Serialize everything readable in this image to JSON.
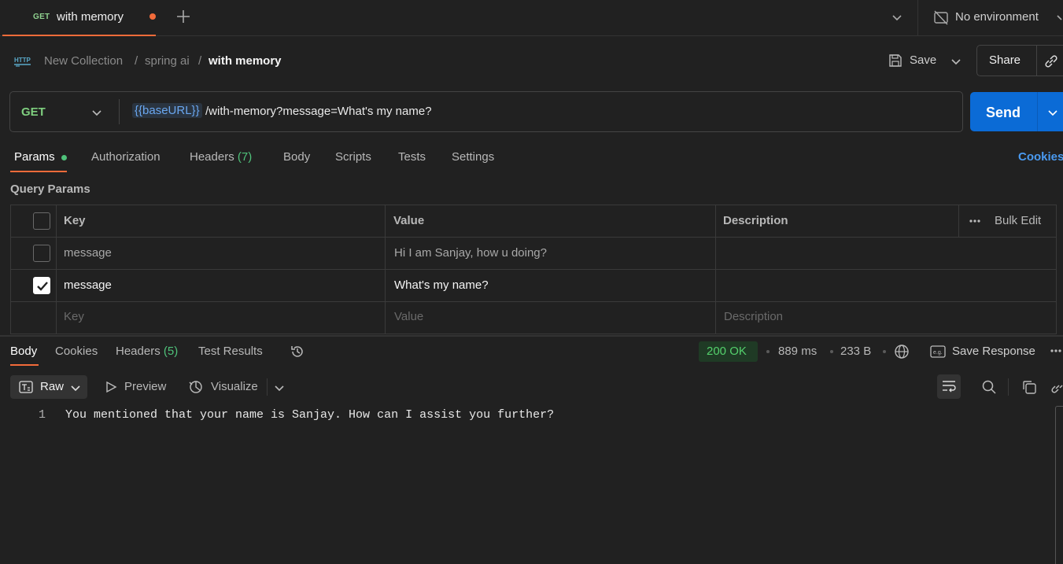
{
  "tab": {
    "method": "GET",
    "name": "with memory",
    "unsaved": true
  },
  "environment": {
    "label": "No environment"
  },
  "breadcrumb": {
    "items": [
      "New Collection",
      "/",
      "spring ai",
      "/",
      "with memory"
    ]
  },
  "toolbar": {
    "save_label": "Save",
    "share_label": "Share"
  },
  "request": {
    "method": "GET",
    "url_variable": "{{baseURL}}",
    "url_path": "/with-memory?message=What's my name?",
    "send_label": "Send"
  },
  "request_tabs": {
    "params": "Params",
    "authorization": "Authorization",
    "headers": "Headers",
    "headers_count": "(7)",
    "body": "Body",
    "scripts": "Scripts",
    "tests": "Tests",
    "settings": "Settings",
    "cookies": "Cookies"
  },
  "query_params": {
    "title": "Query Params",
    "headers": {
      "key": "Key",
      "value": "Value",
      "description": "Description",
      "bulk_edit": "Bulk Edit"
    },
    "rows": [
      {
        "checked": false,
        "key": "message",
        "value": "Hi I am Sanjay, how u doing?",
        "description": ""
      },
      {
        "checked": true,
        "key": "message",
        "value": "What's my name?",
        "description": ""
      }
    ],
    "placeholders": {
      "key": "Key",
      "value": "Value",
      "description": "Description"
    }
  },
  "response_tabs": {
    "body": "Body",
    "cookies": "Cookies",
    "headers": "Headers",
    "headers_count": "(5)",
    "test_results": "Test Results"
  },
  "response_meta": {
    "status": "200 OK",
    "time": "889 ms",
    "size": "233 B",
    "save_response": "Save Response"
  },
  "response_view": {
    "raw": "Raw",
    "preview": "Preview",
    "visualize": "Visualize"
  },
  "response_body": {
    "lines": [
      {
        "number": "1",
        "text": "You mentioned that your name is Sanjay. How can I assist you further?"
      }
    ]
  },
  "colors": {
    "accent": "#f26b3a",
    "send": "#0b6bd6",
    "get_method": "#7fcf7f",
    "status_ok": "#54d06c",
    "variable": "#6aa7f0"
  }
}
